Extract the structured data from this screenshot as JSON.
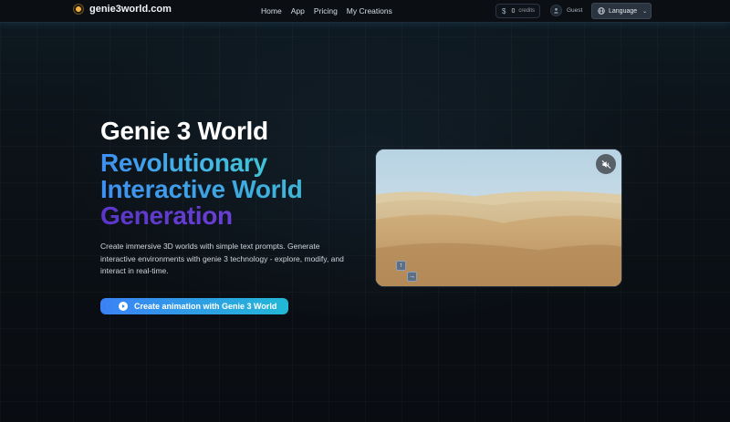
{
  "nav": {
    "brand": "genie3world.com",
    "links": [
      "Home",
      "App",
      "Pricing",
      "My Creations"
    ],
    "credits": {
      "icon": "dollar-icon",
      "count": "0",
      "label": "credits"
    },
    "guest_label": "Guest",
    "language_label": "Language"
  },
  "hero": {
    "title": "Genie 3 World",
    "subtitle_line1": "Revolutionary",
    "subtitle_line2": "Interactive World",
    "subtitle_line3": "Generation",
    "description": "Create immersive 3D worlds with simple text prompts. Generate interactive environments with genie 3 technology - explore, modify, and interact in real-time.",
    "cta_label": "Create animation with Genie 3 World"
  },
  "video": {
    "key_up": "↑",
    "key_right": "→"
  },
  "colors": {
    "accent_blue": "#3b82f6",
    "accent_cyan": "#22b8d6",
    "accent_purple": "#5b36c9",
    "background": "#0b0f14"
  }
}
